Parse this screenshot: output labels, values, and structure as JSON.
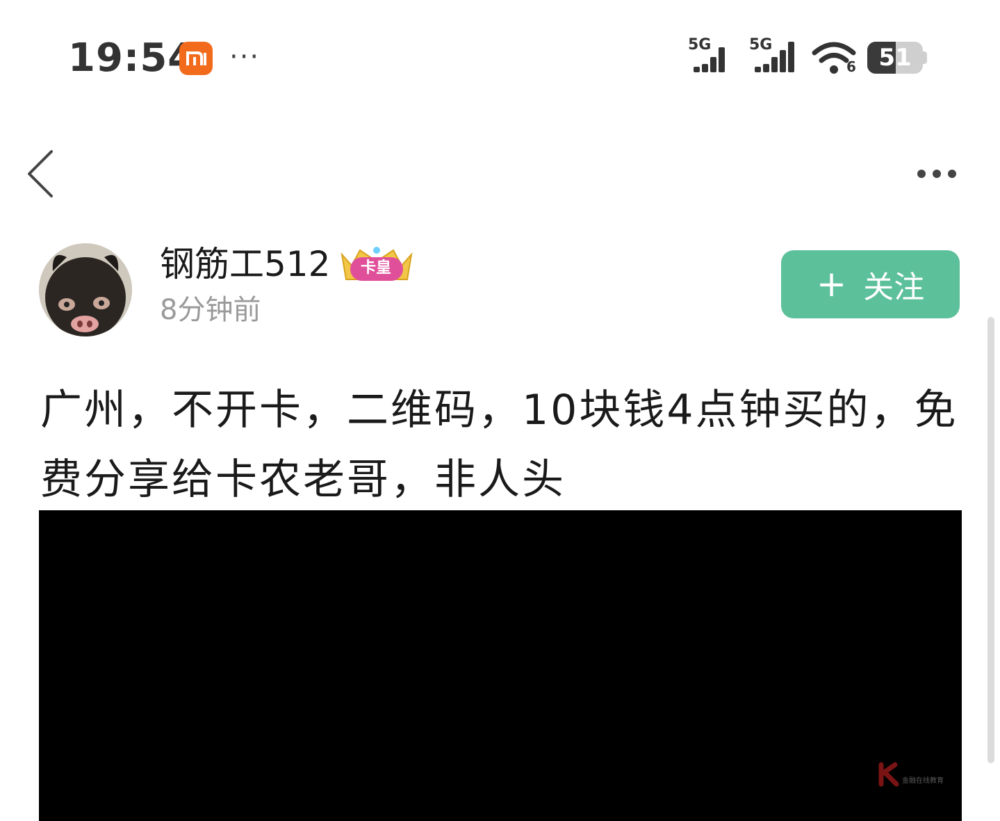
{
  "status_bar": {
    "time": "19:54",
    "notification_icons": [
      "xiaomi-icon",
      "more-notifications-icon"
    ],
    "network_1": "5G",
    "network_2": "5G",
    "wifi_label": "6",
    "battery_level": "51",
    "battery_fraction": 0.51
  },
  "nav": {
    "back_icon": "chevron-left-icon",
    "more_icon": "more-horizontal-icon"
  },
  "post": {
    "author": "钢筋工512",
    "badge": "卡皇",
    "time": "8分钟前",
    "follow_label": "关注",
    "follow_plus": "+",
    "content": "广州，不开卡，二维码，10块钱4点钟买的，免费分享给卡农老哥，非人头",
    "watermark_text": "金融在线教育"
  },
  "colors": {
    "follow_bg": "#5cc09a",
    "mi_orange": "#f26b1d",
    "badge_pink": "#e0509a"
  }
}
